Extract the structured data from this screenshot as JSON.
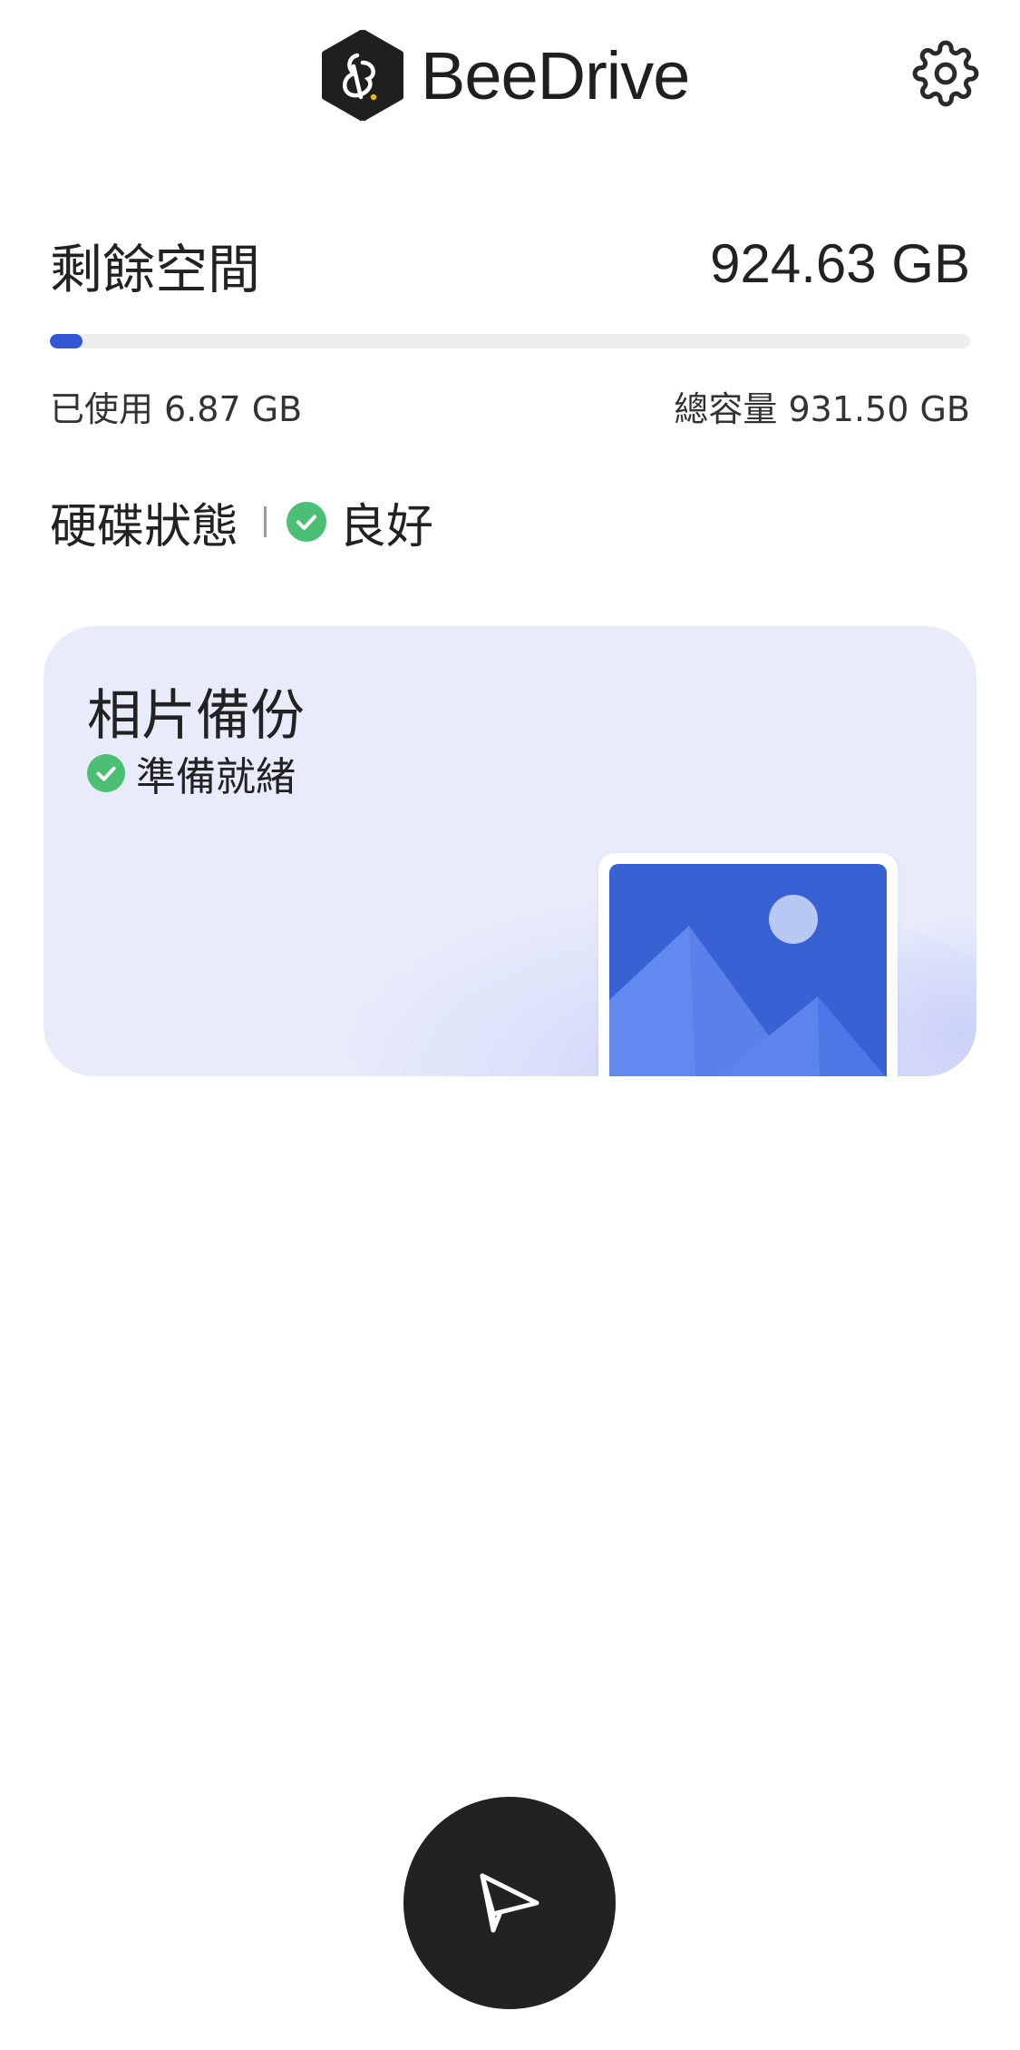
{
  "header": {
    "app_name": "BeeDrive",
    "logo_icon": "beedrive-logo",
    "settings_icon": "gear-icon"
  },
  "storage": {
    "free_label": "剩餘空間",
    "free_value": "924.63 GB",
    "used_label": "已使用",
    "used_value": "6.87 GB",
    "total_label": "總容量",
    "total_value": "931.50 GB",
    "used_fraction": 0.0074,
    "bar_color": "#3258d8"
  },
  "drive_status": {
    "label": "硬碟狀態",
    "value": "良好",
    "status_color": "#4bbf73"
  },
  "photo_backup": {
    "title": "相片備份",
    "status": "準備就緒",
    "illustration_icon": "photo-image-icon"
  },
  "fab": {
    "icon": "send-paper-plane-icon"
  }
}
